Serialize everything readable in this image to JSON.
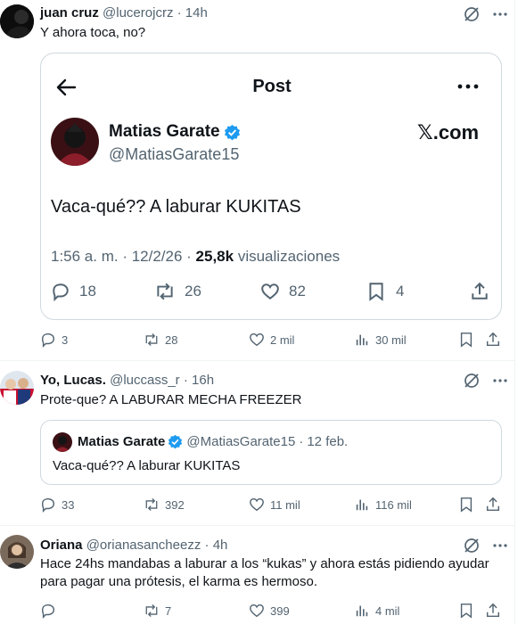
{
  "tweets": [
    {
      "name": "juan cruz",
      "handle": "@lucerojcrz",
      "sep": "·",
      "time": "14h",
      "text": "Y ahora toca, no?",
      "actions": {
        "replies": "3",
        "reposts": "28",
        "likes": "2 mil",
        "views": "30 mil"
      }
    },
    {
      "name": "Yo, Lucas.",
      "handle": "@luccass_r",
      "sep": "·",
      "time": "16h",
      "text": "Prote-que? A LABURAR MECHA FREEZER",
      "actions": {
        "replies": "33",
        "reposts": "392",
        "likes": "11 mil",
        "views": "116 mil"
      }
    },
    {
      "name": "Oriana",
      "handle": "@orianasancheezz",
      "sep": "·",
      "time": "4h",
      "text": "Hace 24hs mandabas a laburar a los “kukas” y ahora estás pidiendo ayudar para pagar una prótesis, el karma es hermoso.",
      "actions": {
        "replies": "",
        "reposts": "7",
        "likes": "399",
        "views": "4 mil"
      }
    }
  ],
  "screenshot": {
    "header_title": "Post",
    "name": "Matias Garate",
    "handle": "@MatiasGarate15",
    "brand": "𝕏.com",
    "text": "Vaca-qué?? A laburar KUKITAS",
    "timestamp": "1:56 a. m. · 12/2/26 ·",
    "views_count": "25,8k",
    "views_label": "visualizaciones",
    "replies": "18",
    "reposts": "26",
    "likes": "82",
    "bookmarks": "4"
  },
  "quote": {
    "name": "Matias Garate",
    "handle": "@MatiasGarate15",
    "sep": "·",
    "date": "12 feb.",
    "text": "Vaca-qué?? A laburar KUKITAS"
  },
  "colors": {
    "text": "#0f1419",
    "secondary": "#536471",
    "verified": "#1d9bf0",
    "border": "#cfd9de"
  },
  "icons": [
    "grok-icon",
    "back-arrow-icon",
    "more-icon",
    "verified-badge-icon",
    "reply-icon",
    "repost-icon",
    "like-icon",
    "views-icon",
    "bookmark-icon",
    "share-icon"
  ]
}
